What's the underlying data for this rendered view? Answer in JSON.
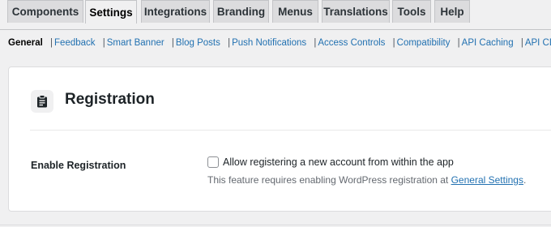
{
  "tabs": [
    {
      "label": "Components",
      "active": false
    },
    {
      "label": "Settings",
      "active": true
    },
    {
      "label": "Integrations",
      "active": false
    },
    {
      "label": "Branding",
      "active": false
    },
    {
      "label": "Menus",
      "active": false
    },
    {
      "label": "Translations",
      "active": false
    },
    {
      "label": "Tools",
      "active": false
    },
    {
      "label": "Help",
      "active": false
    }
  ],
  "subnav": [
    {
      "label": "General",
      "current": true
    },
    {
      "label": "Feedback",
      "current": false
    },
    {
      "label": "Smart Banner",
      "current": false
    },
    {
      "label": "Blog Posts",
      "current": false
    },
    {
      "label": "Push Notifications",
      "current": false
    },
    {
      "label": "Access Controls",
      "current": false
    },
    {
      "label": "Compatibility",
      "current": false
    },
    {
      "label": "API Caching",
      "current": false
    },
    {
      "label": "API CDN",
      "current": false
    }
  ],
  "subnav_separator": "|",
  "section": {
    "icon": "clipboard-icon",
    "title": "Registration"
  },
  "field": {
    "label": "Enable Registration",
    "checkbox_label": "Allow registering a new account from within the app",
    "checked": false,
    "description": "This feature requires enabling WordPress registration at ",
    "link_text": "General Settings",
    "description_end": "."
  },
  "colors": {
    "link": "#2271b1",
    "tab_bg": "#dcdcde",
    "page_bg": "#f0f0f1"
  }
}
